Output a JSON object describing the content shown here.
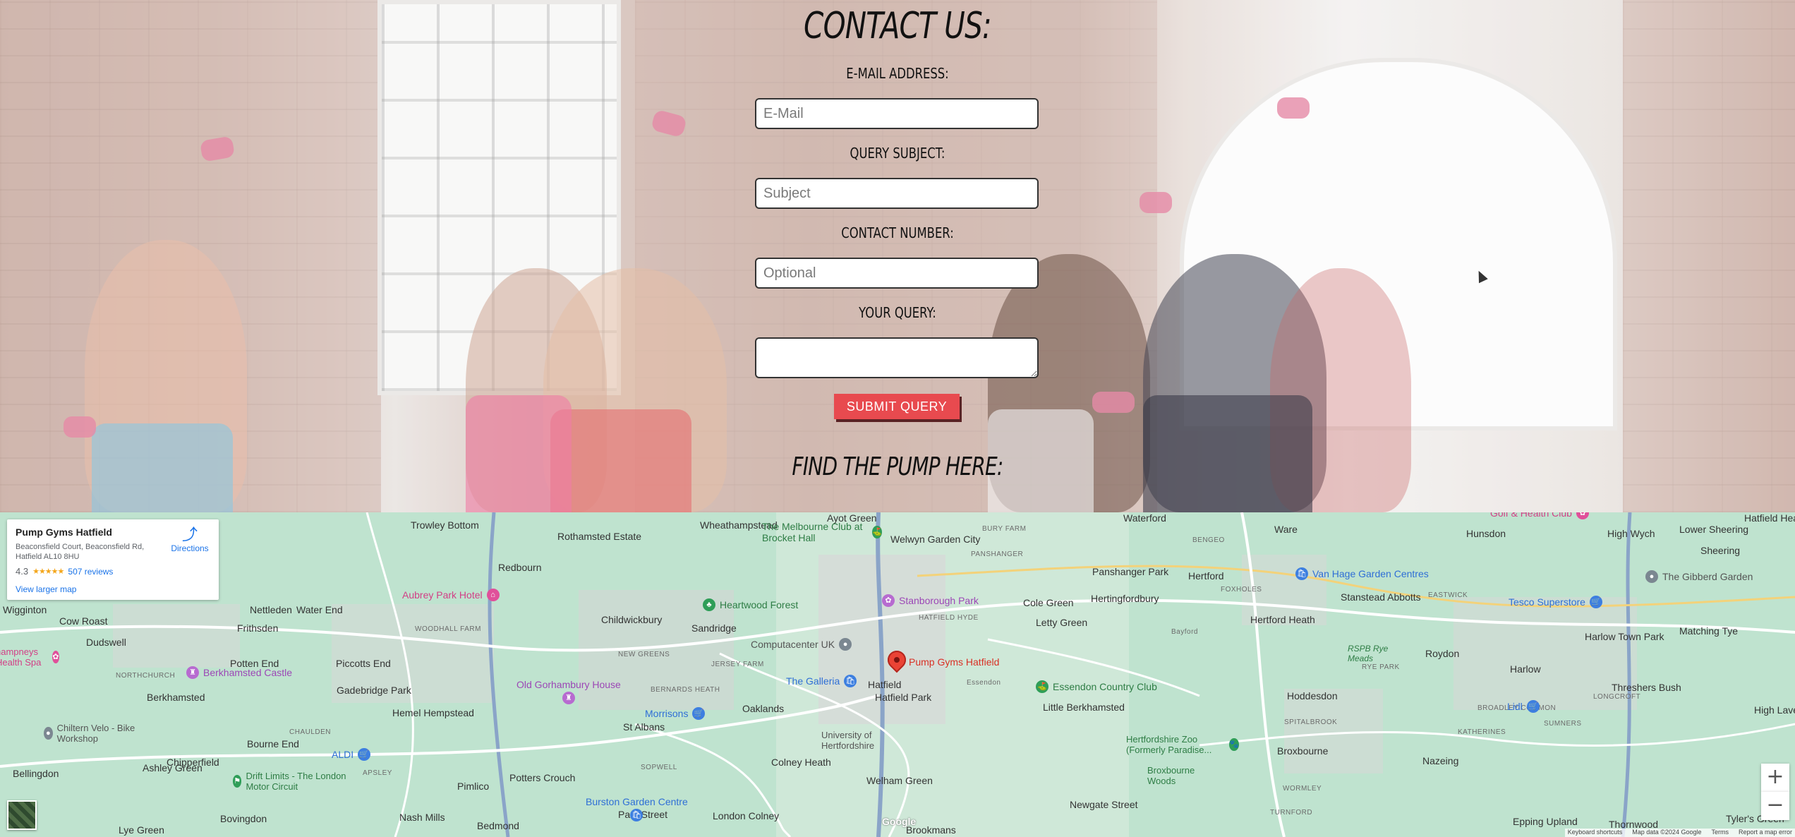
{
  "contact": {
    "title": "CONTACT US:",
    "email_label": "E-MAIL ADDRESS:",
    "email_placeholder": "E-Mail",
    "subject_label": "QUERY SUBJECT:",
    "subject_placeholder": "Subject",
    "number_label": "CONTACT NUMBER:",
    "number_placeholder": "Optional",
    "query_label": "YOUR QUERY:",
    "submit_label": "SUBMIT QUERY",
    "find_title": "FIND THE PUMP HERE:"
  },
  "map": {
    "card": {
      "name": "Pump Gyms Hatfield",
      "address": "Beaconsfield Court, Beaconsfield Rd, Hatfield AL10 8HU",
      "rating": "4.3",
      "stars": "★★★★★",
      "reviews": "507 reviews",
      "view_larger": "View larger map",
      "directions": "Directions"
    },
    "marker_label": "Pump Gyms Hatfield",
    "towns": [
      "Trowley Bottom",
      "Rothamsted Estate",
      "Wheathampstead",
      "Ayot Green",
      "Welwyn Garden City",
      "Waterford",
      "Ware",
      "Hunsdon",
      "High Wych",
      "Lower Sheering",
      "Sheering",
      "Hatfield Heath",
      "Redbourn",
      "Wigginton",
      "Cow Roast",
      "Dudswell",
      "Nettleden",
      "Water End",
      "Frithsden",
      "Potten End",
      "Piccotts End",
      "Berkhamsted",
      "Gadebridge Park",
      "Hemel Hempstead",
      "Bourne End",
      "Chipperfield",
      "Ashley Green",
      "Bellingdon",
      "Bovingdon",
      "Lye Green",
      "Pimlico",
      "Potters Crouch",
      "Nash Mills",
      "Bedmond",
      "Childwickbury",
      "Sandridge",
      "St Albans",
      "Oaklands",
      "Colney Heath",
      "London Colney",
      "Park Street",
      "Hatfield",
      "Hatfield Park",
      "Welham Green",
      "Brookmans",
      "Cole Green",
      "Letty Green",
      "Hertingfordbury",
      "Hertford",
      "Hertford Heath",
      "Stanstead Abbotts",
      "Roydon",
      "Harlow",
      "Matching Tye",
      "Little Berkhamsted",
      "Hoddesdon",
      "Broxbourne",
      "Nazeing",
      "Newgate Street",
      "Threshers Bush",
      "High Laver",
      "Tyler's Green",
      "Epping Upland",
      "Thornwood",
      "Panshanger Park",
      "Harlow Town Park",
      "Bayford",
      "Essendon"
    ],
    "small_labels": [
      "BURY FARM",
      "PANSHANGER",
      "BENGEO",
      "FOXHOLES",
      "EASTWICK",
      "RYE PARK",
      "SPITALBROOK",
      "WORMLEY",
      "TURNFORD",
      "KATHERINES",
      "SUMNERS",
      "BROADLEY COMMON",
      "SOPWELL",
      "BERNARDS HEATH",
      "JERSEY FARM",
      "WOODHALL FARM",
      "NEW GREENS",
      "HATFIELD HYDE",
      "NORTHCHURCH",
      "CHAULDEN",
      "APSLEY",
      "LONGCROFT"
    ],
    "pois": [
      {
        "label": "The Melbourne Club at Brocket Hall",
        "type": "green"
      },
      {
        "label": "Heartwood Forest",
        "type": "green"
      },
      {
        "label": "Stanborough Park",
        "type": "purple"
      },
      {
        "label": "Aubrey Park Hotel",
        "type": "pink"
      },
      {
        "label": "Berkhamsted Castle",
        "type": "purple"
      },
      {
        "label": "Old Gorhambury House",
        "type": "purple"
      },
      {
        "label": "Computacenter UK",
        "type": "gray"
      },
      {
        "label": "The Galleria",
        "type": "blue"
      },
      {
        "label": "Morrisons",
        "type": "blue"
      },
      {
        "label": "University of Hertfordshire",
        "type": "gray"
      },
      {
        "label": "Essendon Country Club",
        "type": "green"
      },
      {
        "label": "Hertfordshire Zoo (Formerly Paradise...",
        "type": "green"
      },
      {
        "label": "Broxbourne Woods",
        "type": "green"
      },
      {
        "label": "Van Hage Garden Centres",
        "type": "blue"
      },
      {
        "label": "Tesco Superstore",
        "type": "blue"
      },
      {
        "label": "Lidl",
        "type": "blue"
      },
      {
        "label": "The Gibberd Garden",
        "type": "gray"
      },
      {
        "label": "Golf & Health Club",
        "type": "pink"
      },
      {
        "label": "Chiltern Velo - Bike Workshop",
        "type": "gray"
      },
      {
        "label": "ALDI",
        "type": "blue"
      },
      {
        "label": "Drift Limits - The London Motor Circuit",
        "type": "green"
      },
      {
        "label": "Burston Garden Centre",
        "type": "blue"
      },
      {
        "label": "hampneys Health Spa",
        "type": "pink"
      },
      {
        "label": "RSPB Rye Meads",
        "type": "green"
      }
    ],
    "attribution": [
      "Keyboard shortcuts",
      "Map data ©2024 Google",
      "Terms",
      "Report a map error"
    ],
    "google_logo": "Google",
    "zoom_in": "+",
    "zoom_out": "−"
  }
}
